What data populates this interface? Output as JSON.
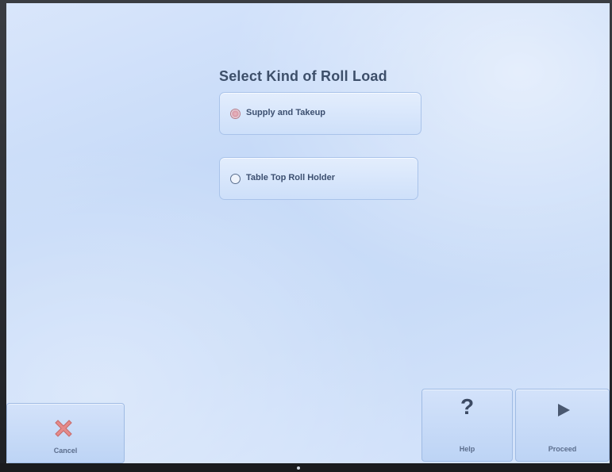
{
  "screen": {
    "title": "Select Kind of Roll Load",
    "options": [
      {
        "label": "Supply and Takeup",
        "selected": true
      },
      {
        "label": "Table Top Roll Holder",
        "selected": false
      }
    ]
  },
  "buttons": {
    "cancel": {
      "label": "Cancel",
      "icon": "x-icon"
    },
    "help": {
      "label": "Help",
      "icon": "question-icon",
      "glyph": "?"
    },
    "proceed": {
      "label": "Proceed",
      "icon": "play-icon"
    }
  },
  "colors": {
    "screen_bg": "#c6daf8",
    "title_text": "#3d4f6a",
    "cancel_x": "#e07b7b",
    "proceed_arrow": "#4a5870"
  }
}
